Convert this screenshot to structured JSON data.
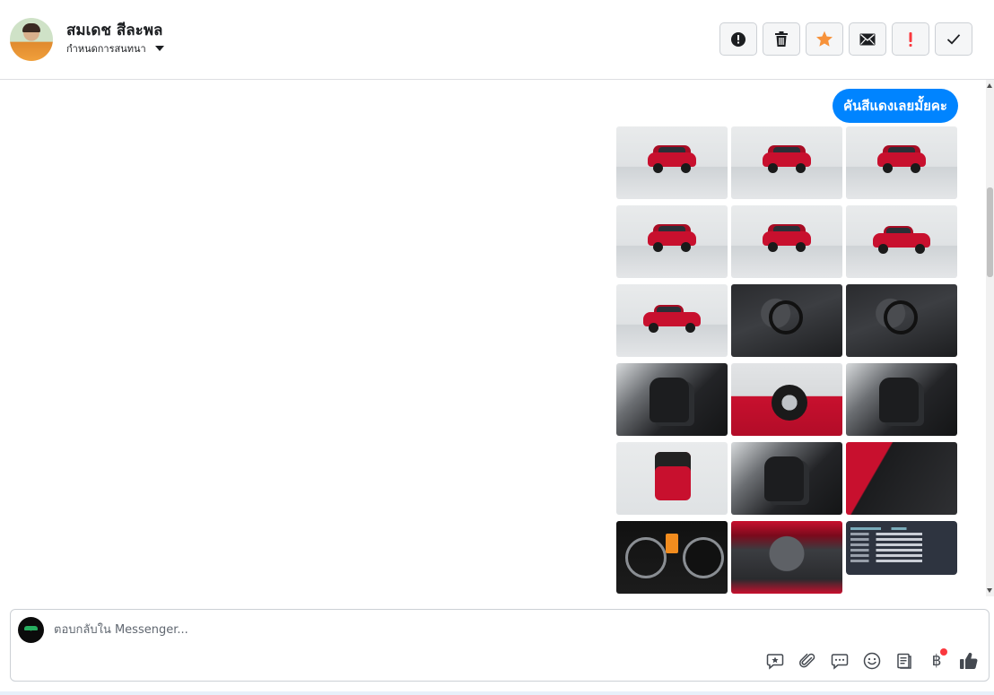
{
  "header": {
    "contact_name": "สมเดช สีละพล",
    "assign_label": "กำหนดการสนทนา",
    "toolbar": [
      {
        "name": "spam-button",
        "icon": "alert-circle-icon"
      },
      {
        "name": "delete-button",
        "icon": "trash-icon"
      },
      {
        "name": "star-button",
        "icon": "star-icon"
      },
      {
        "name": "mark-unread-button",
        "icon": "envelope-icon"
      },
      {
        "name": "follow-up-button",
        "icon": "exclamation-icon"
      },
      {
        "name": "mark-done-button",
        "icon": "checkmark-icon"
      }
    ]
  },
  "colors": {
    "accent": "#0084ff",
    "star": "#f7923a",
    "alert": "#fa383e",
    "car_red": "#c8102e"
  },
  "chat": {
    "message": "คันสีแดงเลยมั้ยคะ",
    "photos": [
      "front",
      "front-three-quarter",
      "rear-three-quarter",
      "rear",
      "rear-three-quarter-left",
      "side-right",
      "side-left",
      "dashboard",
      "interior-front",
      "gear-shifter",
      "wheel",
      "front-seat",
      "open-trunk",
      "rear-seats",
      "door-panel",
      "gauge-cluster",
      "engine-bay",
      "spec-sheet"
    ]
  },
  "composer": {
    "placeholder": "ตอบกลับใน Messenger...",
    "tools": [
      "saved-reply-icon",
      "attachment-icon",
      "chat-bubble-icon",
      "emoji-icon",
      "receipt-icon",
      "baht-icon",
      "thumbs-up-icon"
    ]
  }
}
